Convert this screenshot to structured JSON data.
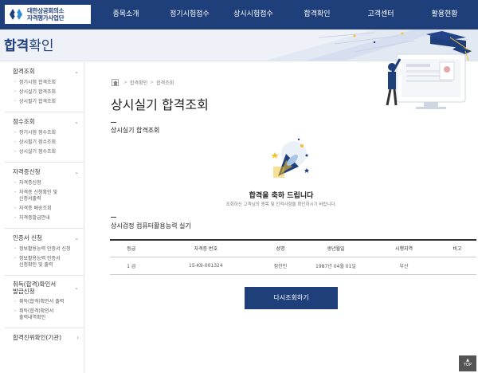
{
  "header": {
    "logo_line1": "대한상공회의소",
    "logo_line2": "자격평가사업단",
    "nav": [
      "종목소개",
      "정기시험접수",
      "상시시험접수",
      "합격확인",
      "고객센터",
      "활용현황"
    ]
  },
  "banner": {
    "title_bold": "합격",
    "title_light": "확인"
  },
  "sidebar": {
    "groups": [
      {
        "label": "합격조회",
        "items": [
          [
            "정기시험 합격조회"
          ],
          [
            "상시실기 합격조회"
          ],
          [
            "상시필기 합격조회"
          ]
        ]
      },
      {
        "label": "점수조회",
        "items": [
          [
            "정기시험 점수조회"
          ],
          [
            "상시필기 점수조회"
          ],
          [
            "상시실기 점수조회"
          ]
        ]
      },
      {
        "label": "자격증신청",
        "items": [
          [
            "자격증신청"
          ],
          [
            "자격증 신청확인 및",
            "신청서출력"
          ],
          [
            "자격증 배송조회"
          ],
          [
            "자격증발급안내"
          ]
        ]
      },
      {
        "label": "인증서 신청",
        "items": [
          [
            "정보활용능력 인증서 신청"
          ],
          [
            "정보활용능력 인증서",
            "신청확인 및 출력"
          ]
        ]
      },
      {
        "label_lines": [
          "취득(합격)확인서",
          "발급신청"
        ],
        "items": [
          [
            "취득(합격)확인서 출력"
          ],
          [
            "취득(합격)확인서",
            "출력내역확인"
          ]
        ]
      },
      {
        "label": "합격진위확인(기관)"
      }
    ]
  },
  "breadcrumb": {
    "items": [
      "합격확인",
      "합격조회"
    ]
  },
  "page_title": "상시실기 합격조회",
  "section1_title": "상시실기 합격조회",
  "congrats": {
    "title": "합격을 축하 드립니다",
    "subtitle": "조회하신 고객님의 종목 및 인적사항을 확인하시기 바랍니다."
  },
  "section2_title": "상시검정 컴퓨터활용능력 실기",
  "table": {
    "headers": [
      "등급",
      "자격증 번호",
      "성명",
      "생년월일",
      "시행지역",
      "비고"
    ],
    "row": [
      "1 급",
      "15-K9-001324",
      "정찬민",
      "1987년 04월 01일",
      "부산",
      ""
    ]
  },
  "retry_button": "다시조회하기",
  "top_button": "TOP",
  "colors": {
    "primary": "#1f3f7b",
    "accent_yellow": "#f2c12e"
  }
}
